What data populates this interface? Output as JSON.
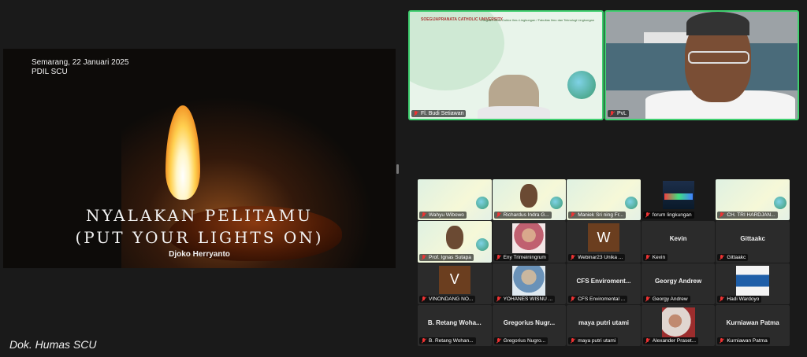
{
  "slide": {
    "meta_line1": "Semarang, 22 Januari 2025",
    "meta_line2": "PDIL SCU",
    "title_line1": "NYALAKAN PELITAMU",
    "title_line2": "(PUT YOUR LIGHTS ON)",
    "author": "Djoko Herryanto"
  },
  "caption": "Dok. Humas SCU",
  "top_videos": [
    {
      "name": "Fl. Budi Setiawan",
      "muted": true,
      "logo": "SOEGIJAPRANATA CATHOLIC UNIVERSITY",
      "header": "Program Studi Doktor Ilmu Lingkungan / Fakultas Ilmu dan Teknologi Lingkungan"
    },
    {
      "name": "PvL",
      "muted": true
    }
  ],
  "participants": [
    {
      "name": "Wahyu Wibowo",
      "style": "greenbg",
      "muted": true
    },
    {
      "name": "Richardus Indra G...",
      "style": "greenbg-face",
      "muted": true
    },
    {
      "name": "Maniek Sri ning Fr...",
      "style": "greenbg",
      "muted": true
    },
    {
      "name": "forum lingkungan",
      "style": "graph",
      "muted": true
    },
    {
      "name": "CH. TRI HARDJAN...",
      "style": "greenbg",
      "muted": true
    },
    {
      "name": "Prof. Ignas Sutapa",
      "style": "greenbg-face",
      "muted": true
    },
    {
      "name": "Eny Trimeiningrum",
      "style": "photo-pink",
      "muted": true
    },
    {
      "name": "Webinar23 Unika ...",
      "style": "avatar-w",
      "avatar": "W",
      "muted": true
    },
    {
      "name": "Kevin",
      "style": "text",
      "label": "Kevin",
      "muted": true
    },
    {
      "name": "Gittaakc",
      "style": "text",
      "label": "Gittaakc",
      "muted": true
    },
    {
      "name": "VINONDANG NO...",
      "style": "avatar-v",
      "avatar": "V",
      "muted": true
    },
    {
      "name": "YOHANES WISNU ...",
      "style": "photo-blue",
      "muted": true
    },
    {
      "name": "CFS Enviromental ...",
      "style": "text",
      "label": "CFS  Enviroment...",
      "muted": true
    },
    {
      "name": "Georgy Andrew",
      "style": "text",
      "label": "Georgy Andrew",
      "muted": true
    },
    {
      "name": "Hadi Wardoyo",
      "style": "photo-sign",
      "muted": true
    },
    {
      "name": "B. Retang Wohan...",
      "style": "text",
      "label": "B. Retang Woha...",
      "muted": true
    },
    {
      "name": "Gregorius Nugro...",
      "style": "text",
      "label": "Gregorius  Nugr...",
      "muted": true
    },
    {
      "name": "maya putri utami",
      "style": "text",
      "label": "maya putri utami",
      "muted": true
    },
    {
      "name": "Alexander Praset...",
      "style": "photo-hand",
      "muted": true
    },
    {
      "name": "Kurniawan Patma",
      "style": "text",
      "label": "Kurniawan Patma",
      "muted": true
    }
  ]
}
